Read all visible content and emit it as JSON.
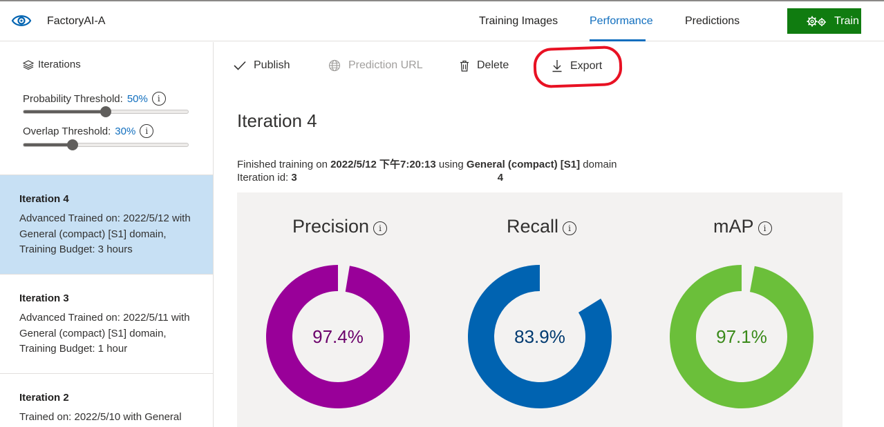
{
  "app": {
    "project_name": "FactoryAI-A"
  },
  "nav": {
    "tabs": [
      {
        "label": "Training Images"
      },
      {
        "label": "Performance",
        "active": true
      },
      {
        "label": "Predictions"
      }
    ],
    "train_label": "Train"
  },
  "sidebar": {
    "iterations_label": "Iterations",
    "probability_threshold": {
      "label": "Probability Threshold:",
      "value": "50%",
      "fraction": 0.5
    },
    "overlap_threshold": {
      "label": "Overlap Threshold:",
      "value": "30%",
      "fraction": 0.3
    },
    "iterations": [
      {
        "title": "Iteration 4",
        "desc": "Advanced Trained on: 2022/5/12 with General (compact) [S1] domain, Training Budget: 3 hours",
        "selected": true
      },
      {
        "title": "Iteration 3",
        "desc": "Advanced Trained on: 2022/5/11 with General (compact) [S1] domain, Training Budget: 1 hour"
      },
      {
        "title": "Iteration 2",
        "desc": "Trained on: 2022/5/10 with General"
      }
    ]
  },
  "toolbar": {
    "publish": "Publish",
    "prediction_url": "Prediction URL",
    "delete": "Delete",
    "export": "Export"
  },
  "main": {
    "title": "Iteration 4",
    "finished_prefix": "Finished training on ",
    "finished_date": "2022/5/12 下午7:20:13",
    "finished_using": " using ",
    "finished_domain": "General (compact) [S1]",
    "finished_suffix": " domain",
    "iteration_id_label": "Iteration id: ",
    "iteration_id_start": "3",
    "iteration_id_end": "4"
  },
  "metrics": [
    {
      "name": "Precision",
      "value": "97.4%",
      "fraction": 0.974,
      "color": "#990099",
      "text_color": "#6b006b"
    },
    {
      "name": "Recall",
      "value": "83.9%",
      "fraction": 0.839,
      "color": "#0063b1",
      "text_color": "#003a70"
    },
    {
      "name": "mAP",
      "value": "97.1%",
      "fraction": 0.971,
      "color": "#6bbf3a",
      "text_color": "#3a8a1a"
    }
  ],
  "colors": {
    "accent": "#106ebe",
    "train_button": "#107c10",
    "selected_iteration": "#c7e0f4",
    "export_highlight": "#e81123"
  }
}
